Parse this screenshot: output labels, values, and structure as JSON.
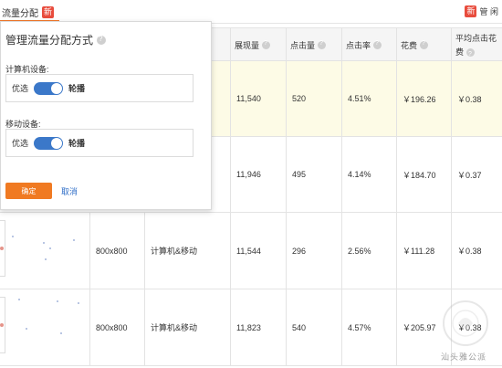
{
  "topbar": {
    "left_label": "流量分配",
    "left_badge": "新",
    "right_badge": "新",
    "right_text": "管 闲"
  },
  "table": {
    "headers": [
      {
        "label": "展现量"
      },
      {
        "label": "点击量"
      },
      {
        "label": "点击率"
      },
      {
        "label": "花费"
      },
      {
        "label_line1": "平均点击花",
        "label_line2": "费"
      }
    ],
    "rows": [
      {
        "size": "",
        "device": "",
        "impressions": "11,540",
        "clicks": "520",
        "ctr": "4.51%",
        "cost": "￥196.26",
        "avg_cpc": "￥0.38"
      },
      {
        "size": "",
        "device": "",
        "impressions": "11,946",
        "clicks": "495",
        "ctr": "4.14%",
        "cost": "￥184.70",
        "avg_cpc": "￥0.37"
      },
      {
        "size": "800x800",
        "device": "计算机&移动",
        "impressions": "11,544",
        "clicks": "296",
        "ctr": "2.56%",
        "cost": "￥111.28",
        "avg_cpc": "￥0.38"
      },
      {
        "size": "800x800",
        "device": "计算机&移动",
        "impressions": "11,823",
        "clicks": "540",
        "ctr": "4.57%",
        "cost": "￥205.97",
        "avg_cpc": "￥0.38"
      }
    ]
  },
  "popup": {
    "title": "管理流量分配方式",
    "computer_label": "计算机设备:",
    "mobile_label": "移动设备:",
    "computer_option_left": "优选",
    "computer_option_right": "轮播",
    "computer_toggle_on": true,
    "mobile_option_left": "优选",
    "mobile_option_right": "轮播",
    "mobile_toggle_on": true,
    "ok_label": "确定",
    "cancel_label": "取消"
  },
  "watermark": {
    "text": "汕头雅公派"
  },
  "colors": {
    "accent": "#f07a22",
    "toggle": "#3b78c9",
    "link": "#2f6ec7",
    "highlight_row": "#fdfbe6",
    "badge": "#e84c3d"
  }
}
